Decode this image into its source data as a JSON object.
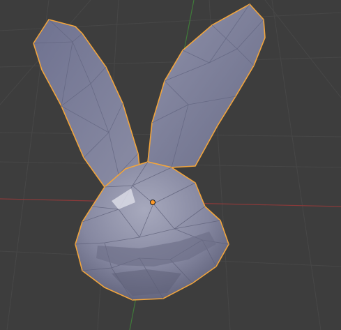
{
  "viewport": {
    "background_color": "#3d3d3d",
    "grid_color": "#474747",
    "x_axis_color": "#8a3a3a",
    "y_axis_color": "#3f7a3a"
  },
  "object": {
    "kind": "low-poly rabbit head mesh",
    "selected": true,
    "outline_color": "#f2a53c",
    "origin_color": "#ff9b2a",
    "base_color": "#8c8ea8"
  }
}
